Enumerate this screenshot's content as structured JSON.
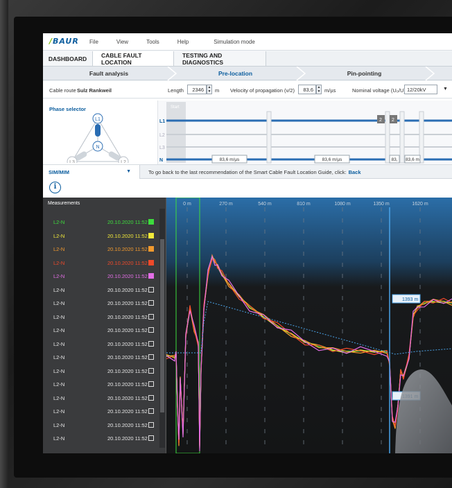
{
  "menu": {
    "logo_text": "BAUR",
    "items": [
      "File",
      "View",
      "Tools",
      "Help"
    ],
    "simulation": "Simulation mode"
  },
  "tabs": [
    "DASHBOARD",
    "CABLE FAULT LOCATION",
    "TESTING AND DIAGNOSTICS"
  ],
  "steps": [
    "Fault analysis",
    "Pre-location",
    "Pin-pointing"
  ],
  "params": {
    "route_label": "Cable route",
    "route_value": "Sulz Rankweil",
    "length_label": "Length",
    "length_value": "2346",
    "length_unit": "m",
    "vop_label": "Velocity of propagation (v/2)",
    "vop_value": "83,6",
    "vop_unit": "m/µs",
    "voltage_label": "Nominal voltage (U₀/U)",
    "voltage_value": "12/20kV"
  },
  "phase": {
    "title": "Phase selector",
    "nodes": [
      "L1",
      "N",
      "L3",
      "L2"
    ],
    "lines": [
      "L1",
      "L2",
      "L3",
      "N"
    ],
    "start_label": "Start",
    "velocity_labels": [
      "83,6 m/µs",
      "83,6 m/µs",
      "83,",
      "83,6 m"
    ],
    "badges": [
      "2",
      "2"
    ]
  },
  "sim": {
    "mode": "SIM/MIM",
    "hint": "To go back to the last recommendation of the Smart Cable Fault Location Guide, click:",
    "back": "Back"
  },
  "measurements": {
    "title": "Measurements",
    "rows": [
      {
        "phase": "L2-N",
        "date": "20.10.2020 11:52",
        "color": "#3ddc3d",
        "checked": true
      },
      {
        "phase": "L2-N",
        "date": "20.10.2020 11:52",
        "color": "#f2e93a",
        "checked": true
      },
      {
        "phase": "L2-N",
        "date": "20.10.2020 11:52",
        "color": "#f29a2e",
        "checked": true
      },
      {
        "phase": "L2-N",
        "date": "20.10.2020 11:52",
        "color": "#f04a2a",
        "checked": true
      },
      {
        "phase": "L2-N",
        "date": "20.10.2020 11:52",
        "color": "#e36ee6",
        "checked": true
      },
      {
        "phase": "L2-N",
        "date": "20.10.2020 11:52",
        "color": "#e8e8e8",
        "checked": false
      },
      {
        "phase": "L2-N",
        "date": "20.10.2020 11:52",
        "color": "#e8e8e8",
        "checked": false
      },
      {
        "phase": "L2-N",
        "date": "20.10.2020 11:52",
        "color": "#e8e8e8",
        "checked": false
      },
      {
        "phase": "L2-N",
        "date": "20.10.2020 11:52",
        "color": "#e8e8e8",
        "checked": false
      },
      {
        "phase": "L2-N",
        "date": "20.10.2020 11:52",
        "color": "#e8e8e8",
        "checked": false
      },
      {
        "phase": "L2-N",
        "date": "20.10.2020 11:52",
        "color": "#e8e8e8",
        "checked": false
      },
      {
        "phase": "L2-N",
        "date": "20.10.2020 11:52",
        "color": "#e8e8e8",
        "checked": false
      },
      {
        "phase": "L2-N",
        "date": "20.10.2020 11:52",
        "color": "#e8e8e8",
        "checked": false
      },
      {
        "phase": "L2-N",
        "date": "20.10.2020 11:52",
        "color": "#e8e8e8",
        "checked": false
      },
      {
        "phase": "L2-N",
        "date": "20.10.2020 11:52",
        "color": "#e8e8e8",
        "checked": false
      },
      {
        "phase": "L2-N",
        "date": "20.10.2020 11:52",
        "color": "#e8e8e8",
        "checked": false
      },
      {
        "phase": "L2-N",
        "date": "20.10.2020 11:52",
        "color": "#e8e8e8",
        "checked": false
      }
    ]
  },
  "chart": {
    "axis_labels": [
      "0 m",
      "270 m",
      "540 m",
      "810 m",
      "1080 m",
      "1350 m",
      "1620 m"
    ],
    "cursor_labels": [
      "1393 m",
      "1391 m"
    ]
  },
  "colors": {
    "accent": "#0b5d9e",
    "green": "#7ab800",
    "chart_bg": "#171819"
  }
}
